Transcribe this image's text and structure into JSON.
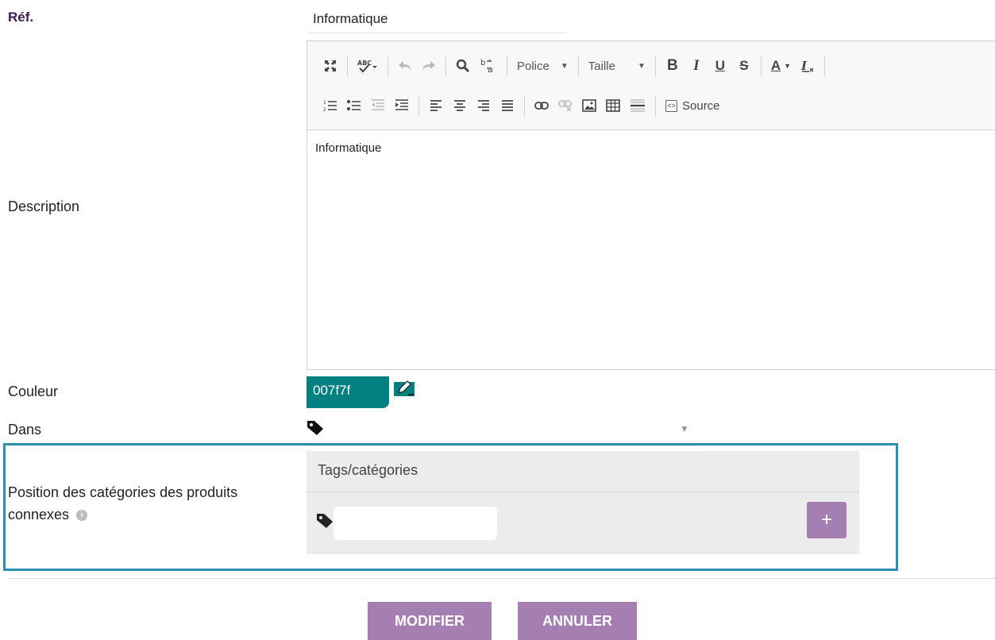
{
  "form": {
    "ref_label": "Réf.",
    "ref_value": "Informatique",
    "description_label": "Description",
    "couleur_label": "Couleur",
    "couleur_value": "007f7f",
    "dans_label": "Dans",
    "position_label_line1": "Position des catégories des produits",
    "position_label_line2": "connexes"
  },
  "editor": {
    "toolbar": {
      "police_label": "Police",
      "taille_label": "Taille",
      "bold_label": "B",
      "italic_label": "I",
      "underline_label": "U",
      "strike_label": "S",
      "font_color_label": "A",
      "source_label": "Source"
    },
    "content": "Informatique"
  },
  "tags_panel": {
    "header": "Tags/catégories",
    "add_label": "+"
  },
  "actions": {
    "modifier_label": "MODIFIER",
    "annuler_label": "ANNULER"
  },
  "colors": {
    "accent_purple": "#a57fb2",
    "swatch_teal": "#008080",
    "highlight_border": "#2a8fae"
  },
  "icons": [
    "maximize-icon",
    "spellcheck-icon",
    "undo-icon",
    "redo-icon",
    "find-icon",
    "replace-icon",
    "remove-format-icon",
    "numbered-list-icon",
    "bullet-list-icon",
    "outdent-icon",
    "indent-icon",
    "align-left-icon",
    "align-center-icon",
    "align-right-icon",
    "justify-icon",
    "link-icon",
    "unlink-icon",
    "image-icon",
    "table-icon",
    "horizontal-rule-icon",
    "pen-icon",
    "tag-icon",
    "info-icon"
  ]
}
